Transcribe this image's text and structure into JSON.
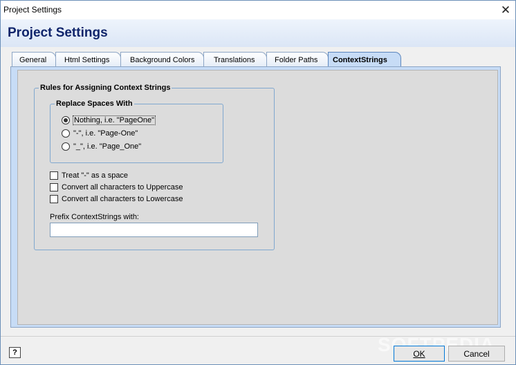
{
  "window": {
    "title": "Project Settings"
  },
  "header": {
    "title": "Project Settings"
  },
  "tabs": [
    {
      "label": "General"
    },
    {
      "label": "Html Settings"
    },
    {
      "label": "Background Colors"
    },
    {
      "label": "Translations"
    },
    {
      "label": "Folder Paths"
    },
    {
      "label": "ContextStrings",
      "active": true
    }
  ],
  "rules_group": {
    "legend": "Rules for Assigning Context Strings",
    "replace_group": {
      "legend": "Replace Spaces With",
      "options": [
        {
          "label": "Nothing, i.e. \"PageOne\"",
          "selected": true
        },
        {
          "label": "\"-\", i.e. \"Page-One\"",
          "selected": false
        },
        {
          "label": "\"_\", i.e. \"Page_One\"",
          "selected": false
        }
      ]
    },
    "checkboxes": [
      {
        "label": "Treat \"-\" as a space",
        "checked": false
      },
      {
        "label": "Convert all characters to Uppercase",
        "checked": false
      },
      {
        "label": "Convert all characters to Lowercase",
        "checked": false
      }
    ],
    "prefix": {
      "label": "Prefix ContextStrings with:",
      "value": ""
    }
  },
  "footer": {
    "help_icon": "?",
    "ok_label": "OK",
    "cancel_label": "Cancel"
  },
  "watermark": "SOFTPEDIA",
  "icons": {
    "close": "close-icon",
    "help": "help-icon"
  },
  "colors": {
    "heading": "#10256b",
    "tab_active": "#c7dcf6",
    "group_border": "#7fa7cf"
  }
}
